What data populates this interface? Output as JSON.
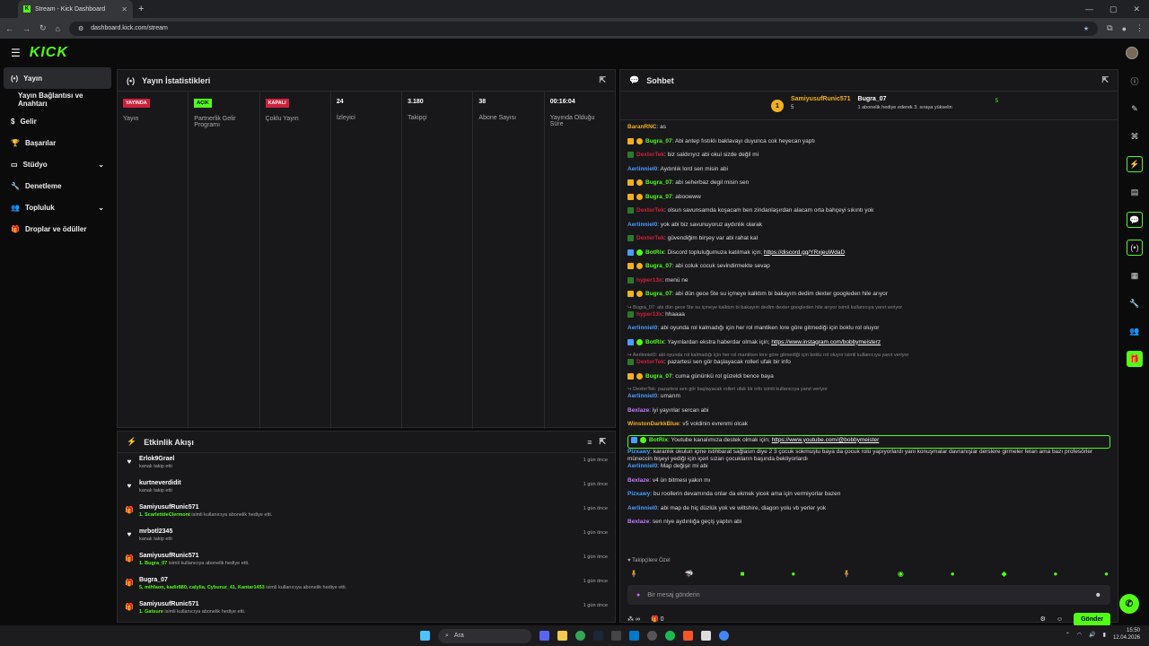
{
  "browser": {
    "tab_title": "Stream - Kick Dashboard",
    "url": "dashboard.kick.com/stream"
  },
  "app": {
    "logo": "KICK"
  },
  "sidebar": {
    "items": [
      {
        "label": "Yayın",
        "icon": "broadcast-icon"
      },
      {
        "label": "Yayın Bağlantısı ve Anahtarı"
      },
      {
        "label": "Gelir",
        "icon": "dollar-icon"
      },
      {
        "label": "Başarılar",
        "icon": "trophy-icon"
      },
      {
        "label": "Stüdyo",
        "icon": "tv-icon"
      },
      {
        "label": "Denetleme",
        "icon": "wrench-icon"
      },
      {
        "label": "Topluluk",
        "icon": "users-icon"
      },
      {
        "label": "Droplar ve ödüller",
        "icon": "gift-icon"
      }
    ]
  },
  "stats": {
    "title": "Yayın İstatistikleri",
    "cols": [
      {
        "badge": "YAYINDA",
        "label": "Yayın"
      },
      {
        "badge": "AÇIK",
        "label": "Partnerlik Gelir Programı"
      },
      {
        "badge": "KAPALI",
        "label": "Çoklu Yayın"
      },
      {
        "value": "24",
        "label": "İzleyici"
      },
      {
        "value": "3.180",
        "label": "Takipçi"
      },
      {
        "value": "38",
        "label": "Abone Sayısı"
      },
      {
        "value": "00:16:04",
        "label": "Yayında Olduğu Süre"
      }
    ]
  },
  "activity": {
    "title": "Etkinlik Akışı",
    "rows": [
      {
        "name": "Erlok9Grael",
        "desc": "kanalı takip etti",
        "time": "1 gün önce"
      },
      {
        "name": "kurtneverdidit",
        "desc": "kanalı takip etti",
        "time": "1 gün önce"
      },
      {
        "name": "SamiyusufRunic571",
        "hl": "1. ScarlettdeClermont",
        "desc": " isimli kullanıcıya abonelik hediye etti.",
        "time": "1 gün önce"
      },
      {
        "name": "mrbotl2345",
        "desc": "kanalı takip etti",
        "time": "1 gün önce"
      },
      {
        "name": "SamiyusufRunic571",
        "hl": "1. Bugra_07",
        "desc": " isimli kullanıcıya abonelik hediye etti.",
        "time": "1 gün önce"
      },
      {
        "name": "Bugra_07",
        "hl": "5, mihfaon, kadir880, calylia, Cyburuz_41, Kantar1453",
        "desc": " isimli kullanıcıya abonelik hediye etti.",
        "time": "1 gün önce"
      },
      {
        "name": "SamiyusufRunic571",
        "hl": "1. Gatsure",
        "desc": " isimli kullanıcıya abonelik hediye etti.",
        "time": "1 gün önce"
      }
    ]
  },
  "chat": {
    "title": "Sohbet",
    "leader": {
      "first": "SamiyusufRunic571",
      "first_count": "5",
      "second": "Bugra_07",
      "second_count": "5",
      "note": "1 abonelik hediye ederek 3. sıraya yükselin"
    },
    "messages": [
      {
        "user": "BaranRNC",
        "text": "as",
        "color": "#f2b01e"
      },
      {
        "user": "Bugra_07",
        "text": "Abi antep fıstıklı baklavayı duyunca cok heyecan yaptı",
        "color": "#53fc18"
      },
      {
        "user": "DexterTek",
        "text": "biz saldırıyız abi okul sizde değil mi",
        "color": "#d0203a"
      },
      {
        "user": "Aerlinniel0",
        "text": "Aydınlık lord sen misin abi",
        "color": "#4a9eff"
      },
      {
        "user": "Bugra_07",
        "text": "abi seherbaz degil misin sen",
        "color": "#53fc18"
      },
      {
        "user": "Bugra_07",
        "text": "aboowww",
        "color": "#53fc18"
      },
      {
        "user": "DexterTek",
        "text": "olsun savunsamda koşacam ben zindanlaşırdan alacam orta bahçeyi sıkıntı yok",
        "color": "#d0203a"
      },
      {
        "user": "Aerlinniel0",
        "text": "yok abi biz savunuyoruz aydınlık olarak",
        "color": "#4a9eff"
      },
      {
        "user": "DexterTek",
        "text": "güvendiğim birşey var abi rahat kal",
        "color": "#d0203a"
      },
      {
        "user": "BotRix",
        "text": "Discord topluluğumuza katılmak için; ",
        "link": "https://discord.gg/YRxjeuWdaD",
        "color": "#53fc18"
      },
      {
        "user": "Bugra_07",
        "text": "abi coluk cocuk sevindirmekte sevap",
        "color": "#53fc18"
      },
      {
        "user": "hyper13x",
        "text": "menü ne",
        "color": "#d0203a"
      },
      {
        "user": "Bugra_07",
        "text": "abi dün gece 5te su içmeye kalktım bi bakayım dedim dexter googleden hile arıyor",
        "color": "#53fc18"
      },
      {
        "reply": "Bugra_07: abi dün gece 5te su içmeye kalktım bi bakayım dedim dexter googleden hile arıyor isimli kullanıcıya yanıt veriyor",
        "user": "hyper13x",
        "text": "hhaaaa",
        "color": "#d0203a"
      },
      {
        "user": "Aerlinniel0",
        "text": "abi oyunda rol kalmadığı için her rol mantiken lore göre gitmediği için boklu rol oluyor",
        "color": "#4a9eff"
      },
      {
        "user": "BotRix",
        "text": "Yayınlardan ekstra haberdar olmak için; ",
        "link": "https://www.instagram.com/bobbymeisterz",
        "color": "#53fc18"
      },
      {
        "reply": "Aerlinniel0: abi oyunda rol kalmadığı için her rol mantiken lore göre gitmediği için boklu rol oluyor isimli kullanıcıya yanıt veriyor",
        "user": "DexterTek",
        "text": "pazartesi sen gör başlayacak rolleri ufak bir info",
        "color": "#d0203a"
      },
      {
        "user": "Bugra_07",
        "text": "cuma gününkü rol güzeldi bence baya",
        "color": "#53fc18"
      },
      {
        "reply": "DexterTek: pazartesi sen gör başlayacak rolleri ufak bir info isimli kullanıcıya yanıt veriyor",
        "user": "Aerlinniel0",
        "text": "umarım",
        "color": "#4a9eff"
      },
      {
        "user": "Bexlaze",
        "text": "iyi yayınlar sercan abi",
        "color": "#c27cff"
      },
      {
        "user": "WinstonDarkkBlue",
        "text": "v5 voldinin evrenmi olcak",
        "color": "#f2b01e"
      },
      {
        "user": "BotRix",
        "text": "Youtube kanalımıza destek olmak için; ",
        "link": "https://www.youtube.com/@bobbymeister",
        "color": "#53fc18",
        "highlight": true
      },
      {
        "user": "Pizxawy",
        "text": "karanlık okulun içine istihbarat sağlasın diye 2 3 çocuk sokmuştu baya da çocuk rolü yapıyorlardı yani konuşmalar davranışlar derslere girmeler felan ama bazı profesörler müneccin bişeyi yediği için içeri sızan çocukların başında bekliyorlardı",
        "color": "#4a9eff"
      },
      {
        "user": "Aerlinniel0",
        "text": "Map değişir mi abi",
        "color": "#4a9eff"
      },
      {
        "user": "Bexlaze",
        "text": "v4 ün bitmesi yakın mı",
        "color": "#c27cff"
      },
      {
        "user": "Pizxawy",
        "text": "bu roollerin devamında onlar da ekmek yicek ama için vermiyorlar bazen",
        "color": "#4a9eff"
      },
      {
        "user": "Aerlinniel0",
        "text": "abi map de hiç düzlük yok ve wiltshire, diagon yolu vb yerler yok",
        "color": "#4a9eff"
      },
      {
        "user": "Bexlaze",
        "text": "sen niye aydınlığa geçiş yaptın abi",
        "color": "#c27cff"
      }
    ],
    "pinned_label": "Takipçilere Özel",
    "input_placeholder": "Bir mesaj gönderin",
    "infinity_count": "∞",
    "gift_count": "0",
    "send_label": "Gönder"
  },
  "taskbar": {
    "search": "Ara",
    "time": "15:50",
    "date": "12.04.2026"
  }
}
